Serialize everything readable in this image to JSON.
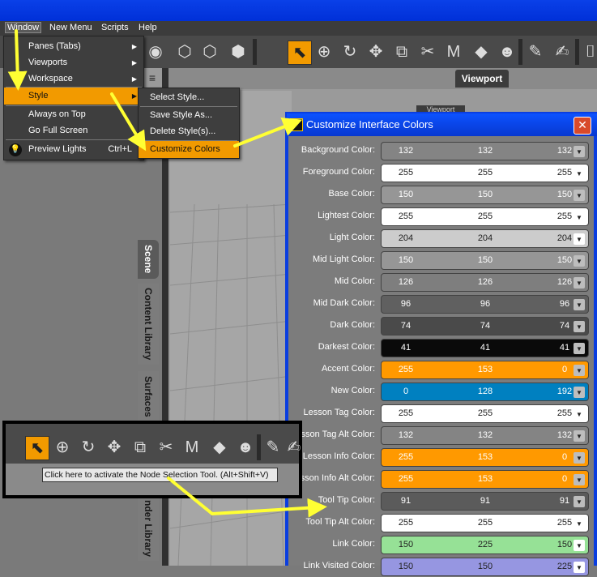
{
  "menubar": {
    "items": [
      "Window",
      "New Menu",
      "Scripts",
      "Help"
    ]
  },
  "window_menu": {
    "items": [
      {
        "label": "Panes (Tabs)",
        "submenu": true
      },
      {
        "label": "Viewports",
        "submenu": true
      },
      {
        "label": "Workspace",
        "submenu": true
      },
      {
        "label": "Style",
        "submenu": true,
        "highlighted": true
      },
      {
        "label": "Always on Top"
      },
      {
        "label": "Go Full Screen"
      },
      {
        "label": "Preview Lights",
        "shortcut": "Ctrl+L"
      }
    ]
  },
  "style_submenu": {
    "items": [
      {
        "label": "Select Style..."
      },
      {
        "label": "Save Style As..."
      },
      {
        "label": "Delete Style(s)..."
      },
      {
        "label": "Customize Colors",
        "highlighted": true
      }
    ]
  },
  "side_tabs": [
    "Scene",
    "Content Library",
    "Surfaces",
    "nder Library"
  ],
  "viewport": {
    "tab_label": "Viewport",
    "behind_label": "Viewport"
  },
  "dialog": {
    "title": "Customize Interface Colors",
    "close_glyph": "✕",
    "rows": [
      {
        "label": "Background Color:",
        "values": [
          132,
          132,
          132
        ],
        "bg": "#848484",
        "fg": "#ffffff"
      },
      {
        "label": "Foreground Color:",
        "values": [
          255,
          255,
          255
        ],
        "bg": "#ffffff",
        "fg": "#222222"
      },
      {
        "label": "Base Color:",
        "values": [
          150,
          150,
          150
        ],
        "bg": "#969696",
        "fg": "#ffffff"
      },
      {
        "label": "Lightest Color:",
        "values": [
          255,
          255,
          255
        ],
        "bg": "#ffffff",
        "fg": "#222222"
      },
      {
        "label": "Light Color:",
        "values": [
          204,
          204,
          204
        ],
        "bg": "#cccccc",
        "fg": "#222222"
      },
      {
        "label": "Mid Light Color:",
        "values": [
          150,
          150,
          150
        ],
        "bg": "#969696",
        "fg": "#ffffff"
      },
      {
        "label": "Mid Color:",
        "values": [
          126,
          126,
          126
        ],
        "bg": "#7e7e7e",
        "fg": "#ffffff"
      },
      {
        "label": "Mid Dark Color:",
        "values": [
          96,
          96,
          96
        ],
        "bg": "#606060",
        "fg": "#ffffff"
      },
      {
        "label": "Dark Color:",
        "values": [
          74,
          74,
          74
        ],
        "bg": "#4a4a4a",
        "fg": "#ffffff"
      },
      {
        "label": "Darkest Color:",
        "values": [
          41,
          41,
          41
        ],
        "bg": "#0a0a0a",
        "fg": "#ffffff"
      },
      {
        "label": "Accent Color:",
        "values": [
          255,
          153,
          0
        ],
        "bg": "#ff9900",
        "fg": "#ffffff"
      },
      {
        "label": "New Color:",
        "values": [
          0,
          128,
          192
        ],
        "bg": "#0080c0",
        "fg": "#ffffff"
      },
      {
        "label": "Lesson Tag Color:",
        "values": [
          255,
          255,
          255
        ],
        "bg": "#ffffff",
        "fg": "#222222"
      },
      {
        "label": "esson Tag Alt Color:",
        "values": [
          132,
          132,
          132
        ],
        "bg": "#848484",
        "fg": "#ffffff"
      },
      {
        "label": "Lesson Info Color:",
        "values": [
          255,
          153,
          0
        ],
        "bg": "#ff9900",
        "fg": "#ffffff"
      },
      {
        "label": "esson Info Alt Color:",
        "values": [
          255,
          153,
          0
        ],
        "bg": "#ff9900",
        "fg": "#ffffff"
      },
      {
        "label": "Tool Tip Color:",
        "values": [
          91,
          91,
          91
        ],
        "bg": "#5b5b5b",
        "fg": "#ffffff"
      },
      {
        "label": "Tool Tip Alt Color:",
        "values": [
          255,
          255,
          255
        ],
        "bg": "#ffffff",
        "fg": "#222222"
      },
      {
        "label": "Link Color:",
        "values": [
          150,
          225,
          150
        ],
        "bg": "#96e196",
        "fg": "#222222"
      },
      {
        "label": "Link Visited Color:",
        "values": [
          150,
          150,
          225
        ],
        "bg": "#9696e1",
        "fg": "#222222"
      }
    ]
  },
  "inset": {
    "tooltip": "Click here to activate the Node Selection Tool. (Alt+Shift+V)"
  },
  "colors": {
    "accent": "#f29a00",
    "arrow": "#ffff33",
    "title_blue": "#0a3ee0"
  }
}
